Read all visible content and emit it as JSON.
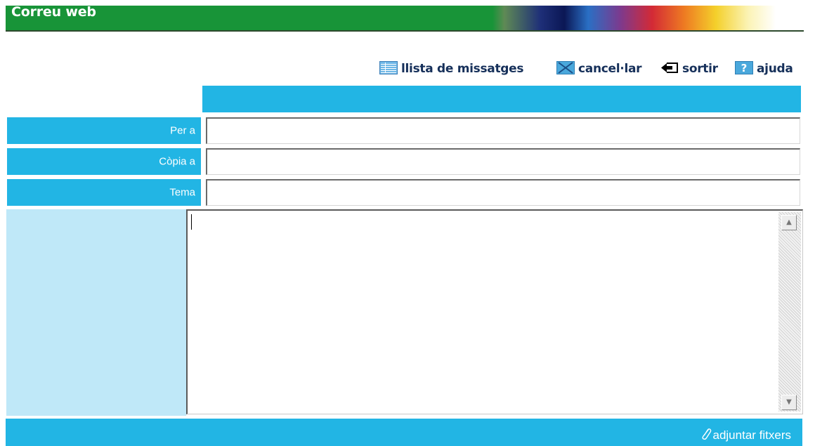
{
  "header": {
    "title": "Correu web"
  },
  "toolbar": {
    "items": [
      {
        "label": "llista de missatges",
        "icon": "list-icon"
      },
      {
        "label": "cancel·lar",
        "icon": "cancel-icon"
      },
      {
        "label": "sortir",
        "icon": "exit-arrow-icon"
      },
      {
        "label": "ajuda",
        "icon": "help-icon"
      }
    ]
  },
  "form": {
    "to_label": "Per a",
    "to_value": "",
    "cc_label": "Còpia a",
    "cc_value": "",
    "subject_label": "Tema",
    "subject_value": "",
    "body_value": ""
  },
  "footer": {
    "attach_label": "adjuntar fitxers",
    "attach_icon": "paperclip-icon"
  },
  "colors": {
    "header_green": "#189438",
    "accent_blue": "#22b5e4",
    "light_blue": "#bfe8f8",
    "toolbar_text": "#16305a"
  }
}
